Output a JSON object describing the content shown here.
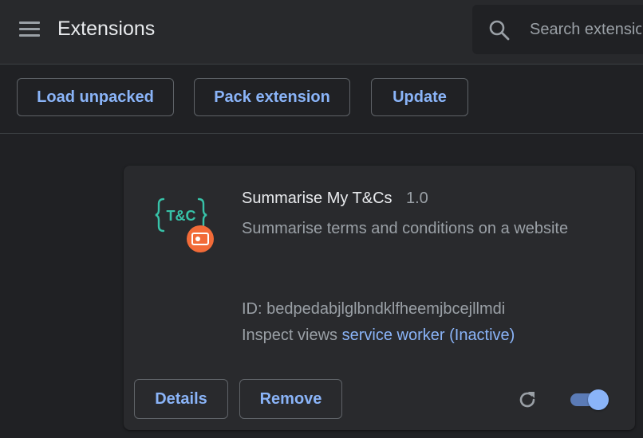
{
  "header": {
    "title": "Extensions",
    "menu_icon": "hamburger-menu-icon",
    "search": {
      "icon": "search-icon",
      "placeholder": "Search extensions"
    }
  },
  "toolbar": {
    "load_unpacked_label": "Load unpacked",
    "pack_extension_label": "Pack extension",
    "update_label": "Update"
  },
  "extension": {
    "icon": "tc-extension-icon",
    "name": "Summarise My T&Cs",
    "version": "1.0",
    "description": "Summarise terms and conditions on a website",
    "id_text": "ID: bedpedabjlglbndklfheemjbcejllmdi",
    "inspect_label": "Inspect views",
    "inspect_link": "service worker (Inactive)",
    "details_label": "Details",
    "remove_label": "Remove",
    "reload_icon": "reload-icon",
    "enabled": true
  },
  "colors": {
    "background": "#202124",
    "header": "#28292c",
    "card": "#292a2d",
    "accent": "#8ab4f8",
    "icon_teal": "#37c2a8",
    "badge_orange": "#f26b38"
  }
}
